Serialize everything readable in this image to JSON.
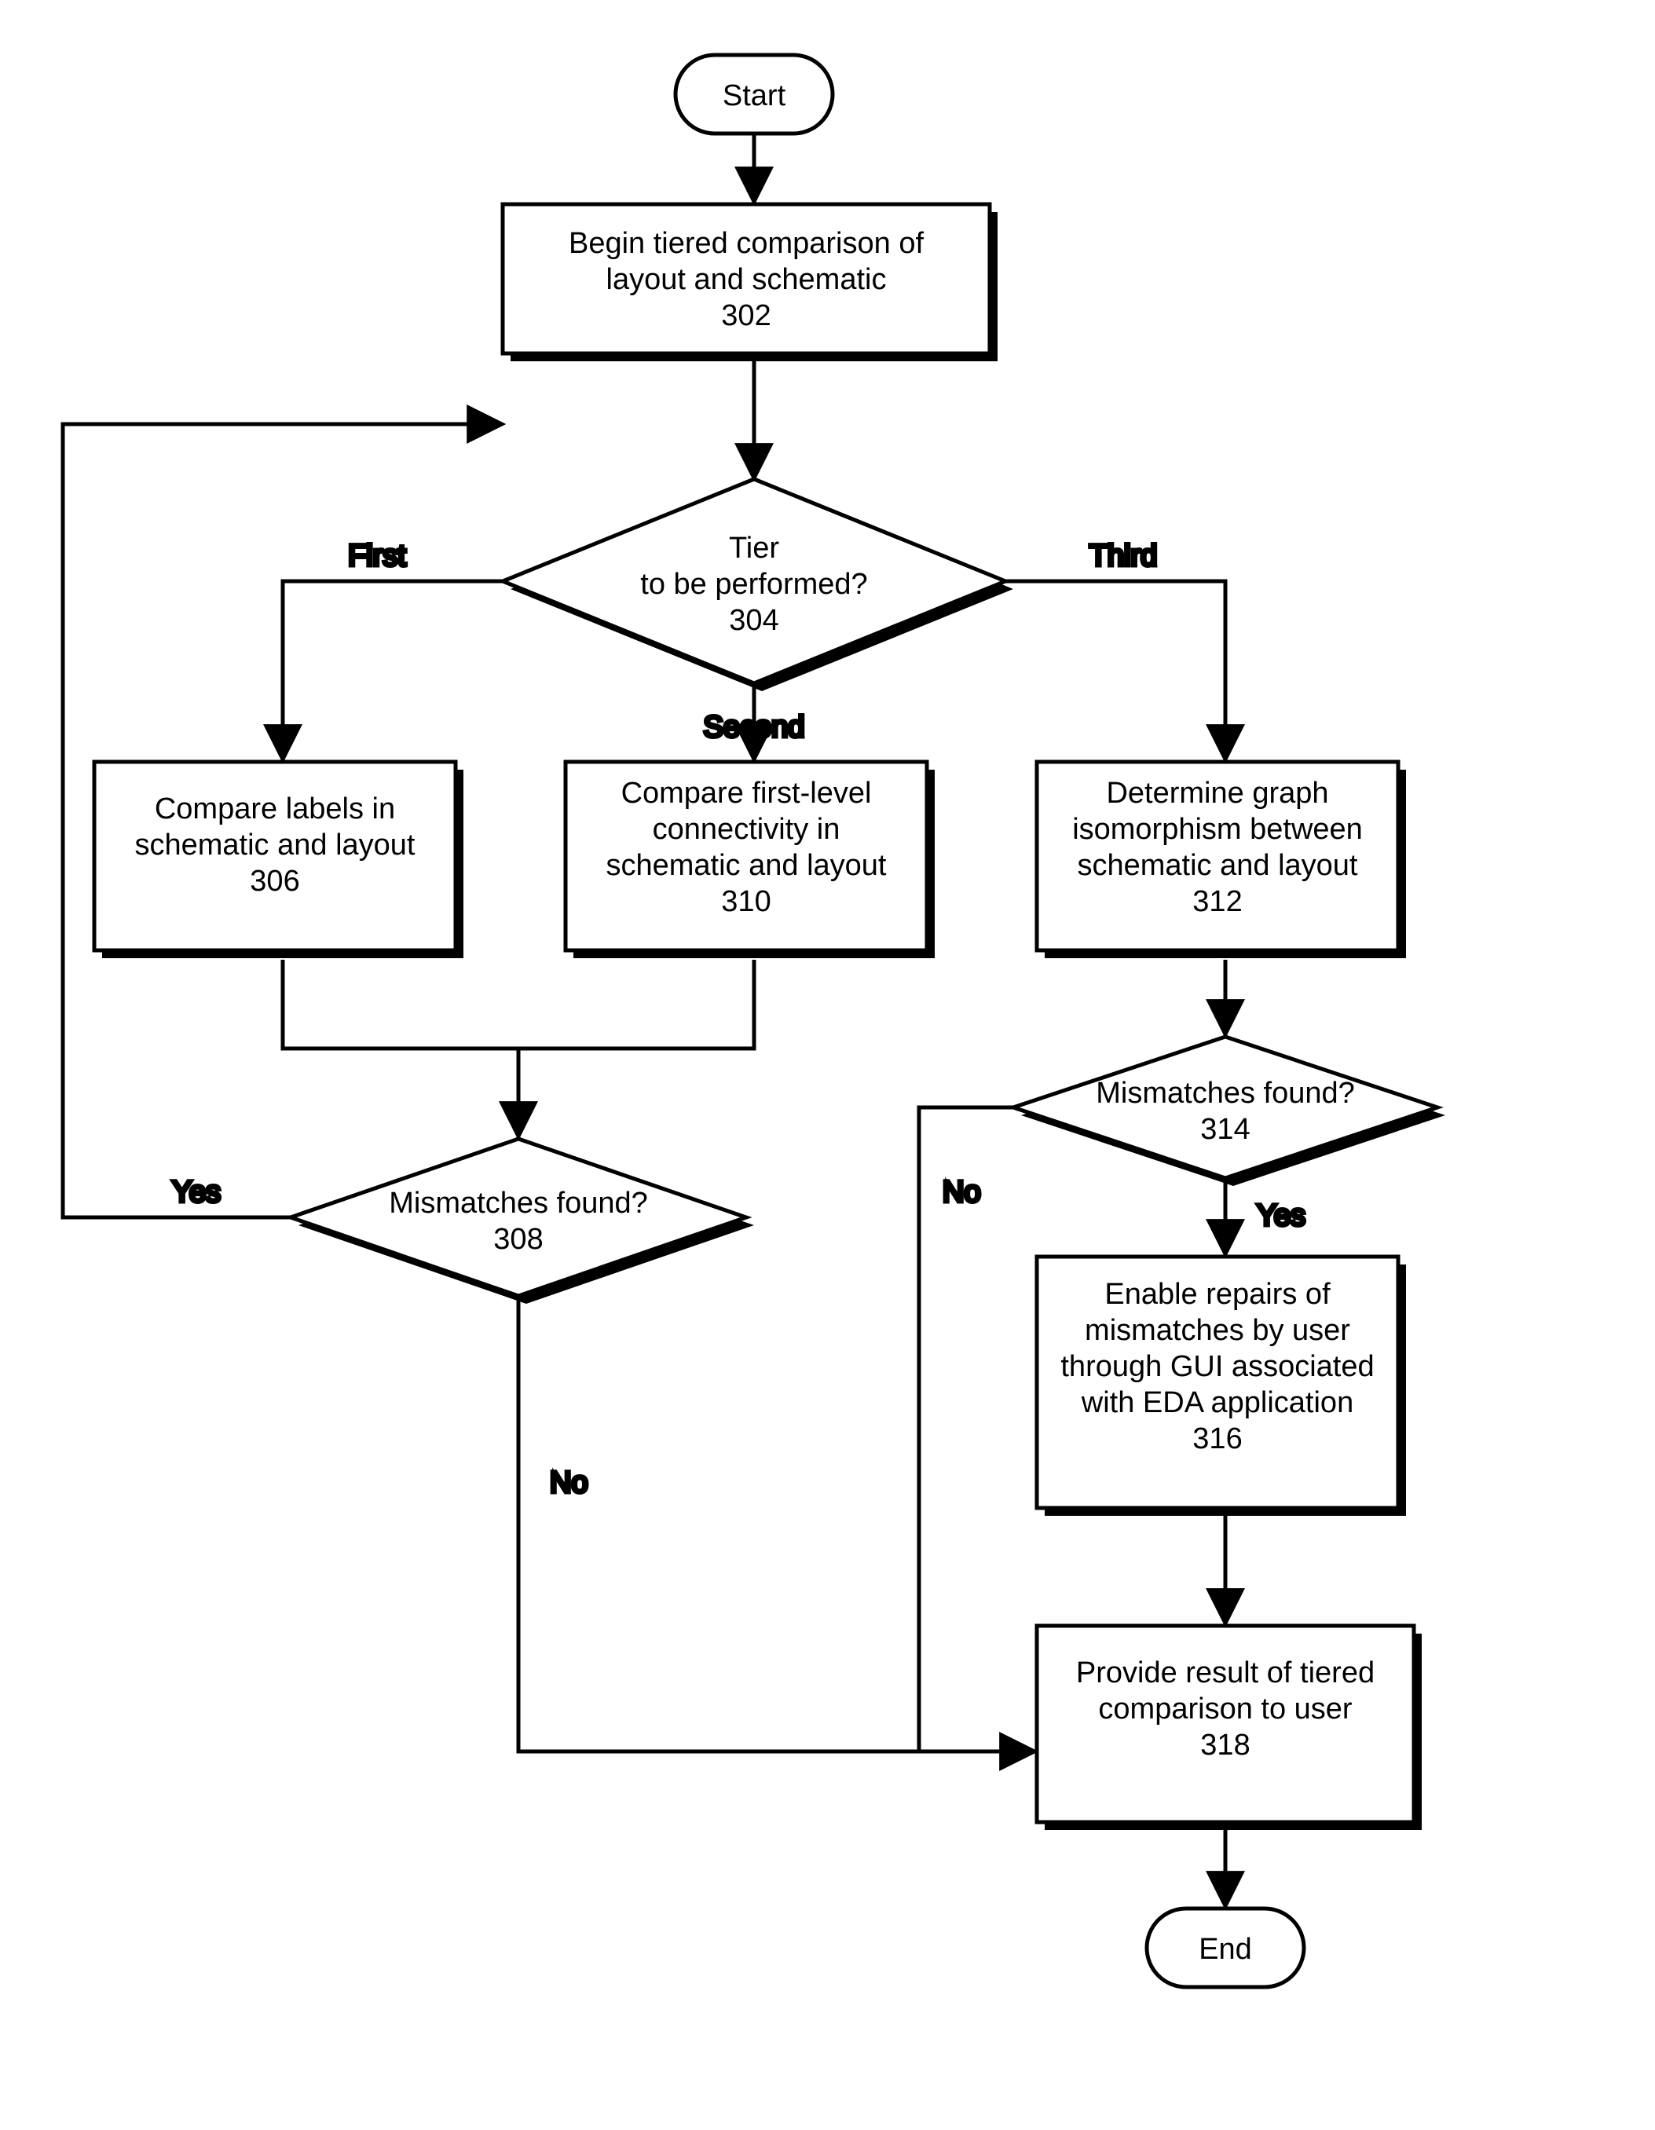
{
  "chart_data": {
    "type": "flowchart",
    "nodes": {
      "start": {
        "kind": "terminator",
        "lines": [
          "Start"
        ]
      },
      "n302": {
        "kind": "process",
        "lines": [
          "Begin tiered comparison of",
          "layout and schematic",
          "302"
        ]
      },
      "n304": {
        "kind": "decision",
        "lines": [
          "Tier",
          "to be performed?",
          "304"
        ]
      },
      "n306": {
        "kind": "process",
        "lines": [
          "Compare labels in",
          "schematic and layout",
          "306"
        ]
      },
      "n310": {
        "kind": "process",
        "lines": [
          "Compare first-level",
          "connectivity in",
          "schematic and layout",
          "310"
        ]
      },
      "n312": {
        "kind": "process",
        "lines": [
          "Determine graph",
          "isomorphism between",
          "schematic and layout",
          "312"
        ]
      },
      "n308": {
        "kind": "decision",
        "lines": [
          "Mismatches found?",
          "308"
        ]
      },
      "n314": {
        "kind": "decision",
        "lines": [
          "Mismatches found?",
          "314"
        ]
      },
      "n316": {
        "kind": "process",
        "lines": [
          "Enable repairs of",
          "mismatches by user",
          "through GUI associated",
          "with EDA application",
          "316"
        ]
      },
      "n318": {
        "kind": "process",
        "lines": [
          "Provide result of tiered",
          "comparison to user",
          "318"
        ]
      },
      "end": {
        "kind": "terminator",
        "lines": [
          "End"
        ]
      }
    },
    "edges": [
      {
        "from": "start",
        "to": "n302"
      },
      {
        "from": "n302",
        "to": "n304"
      },
      {
        "from": "n304",
        "to": "n306",
        "label": "First"
      },
      {
        "from": "n304",
        "to": "n310",
        "label": "Second"
      },
      {
        "from": "n304",
        "to": "n312",
        "label": "Third"
      },
      {
        "from": "n306",
        "to": "n308"
      },
      {
        "from": "n310",
        "to": "n308"
      },
      {
        "from": "n308",
        "to": "n302",
        "label": "Yes"
      },
      {
        "from": "n308",
        "to": "n318",
        "label": "No"
      },
      {
        "from": "n312",
        "to": "n314"
      },
      {
        "from": "n314",
        "to": "n316",
        "label": "Yes"
      },
      {
        "from": "n314",
        "to": "n318",
        "label": "No"
      },
      {
        "from": "n316",
        "to": "n318"
      },
      {
        "from": "n318",
        "to": "end"
      }
    ],
    "edge_labels": {
      "first": "First",
      "second": "Second",
      "third": "Third",
      "yes": "Yes",
      "no": "No"
    }
  }
}
